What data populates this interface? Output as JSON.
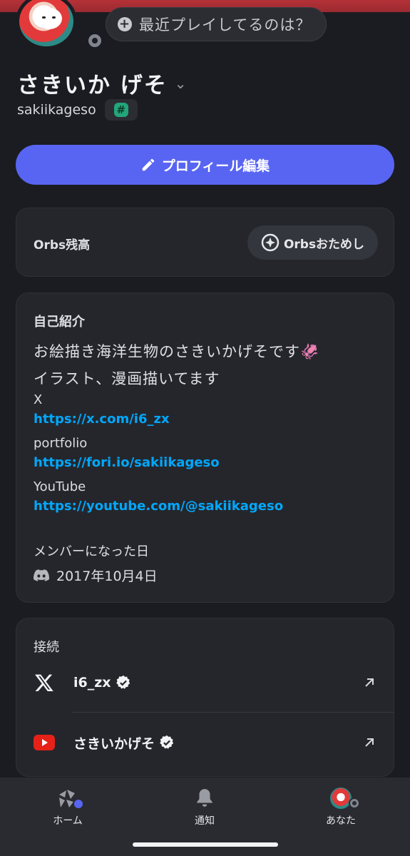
{
  "header": {
    "activity_prompt": "最近プレイしてるのは？",
    "display_name": "さきいか げそ",
    "username": "sakiikageso",
    "tag_symbol": "#"
  },
  "actions": {
    "edit_profile_label": "プロフィール編集"
  },
  "orbs": {
    "balance_label": "Orbs残高",
    "try_button_label": "Orbsおためし"
  },
  "bio": {
    "section_title": "自己紹介",
    "line1": "お絵描き海洋生物のさきいかげそです🦑",
    "line2": "イラスト、漫画描いてます",
    "x_label": "X",
    "x_link": "https://x.com/i6_zx",
    "portfolio_label": "portfolio",
    "portfolio_link": "https://fori.io/sakiikageso",
    "youtube_label": "YouTube",
    "youtube_link": "https://youtube.com/@sakiikageso",
    "member_since_title": "メンバーになった日",
    "member_since_date": "2017年10月4日"
  },
  "connections": {
    "section_title": "接続",
    "items": [
      {
        "service": "x-icon",
        "name": "i6_zx",
        "verified": true
      },
      {
        "service": "youtube-icon",
        "name": "さきいかげそ",
        "verified": true
      }
    ]
  },
  "nav": {
    "items": [
      {
        "label": "ホーム",
        "icon": "home-icon"
      },
      {
        "label": "通知",
        "icon": "bell-icon"
      },
      {
        "label": "あなた",
        "icon": "avatar"
      }
    ]
  },
  "colors": {
    "accent": "#5865f2",
    "link": "#00a8fc",
    "background": "#1b1c21",
    "card": "#25262c",
    "banner": "#b53138"
  }
}
